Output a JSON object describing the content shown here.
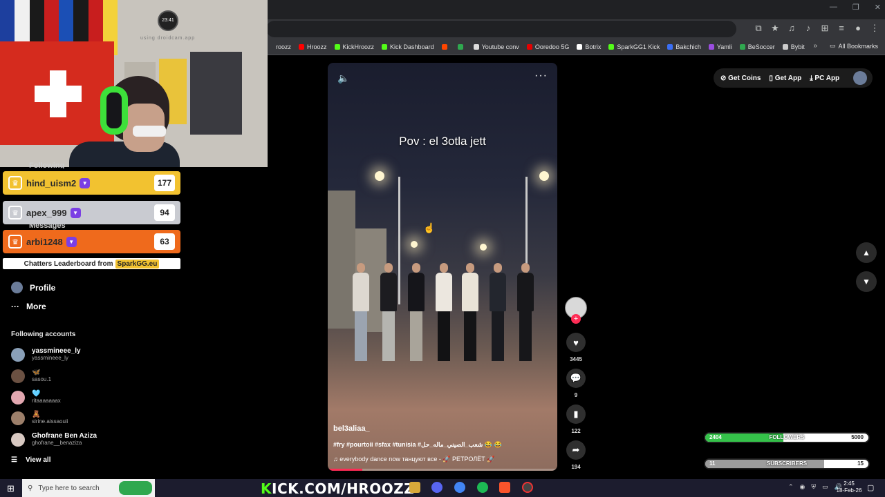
{
  "browser": {
    "window_controls": [
      "—",
      "❐",
      "✕"
    ],
    "toolbar_icons": [
      "screen-cast-icon",
      "star-icon",
      "music-icon",
      "audio-icon",
      "extensions-icon",
      "tab-search-icon",
      "profile-icon",
      "menu-icon"
    ],
    "bookmarks": [
      {
        "label": "roozz",
        "color": "#35363a"
      },
      {
        "label": "Hroozz",
        "color": "#ff0000"
      },
      {
        "label": "KickHroozz",
        "color": "#53fc18"
      },
      {
        "label": "Kick Dashboard",
        "color": "#53fc18"
      },
      {
        "label": "",
        "color": "#ff4500"
      },
      {
        "label": "",
        "color": "#2fa84f"
      },
      {
        "label": "Youtube conv",
        "color": "#dddddd"
      },
      {
        "label": "Ooredoo 5G",
        "color": "#e60000"
      },
      {
        "label": "Botrix",
        "color": "#ffffff"
      },
      {
        "label": "SparkGG1 Kick",
        "color": "#53fc18"
      },
      {
        "label": "Bakchich",
        "color": "#3a6ff7"
      },
      {
        "label": "Yamli",
        "color": "#9b4de0"
      },
      {
        "label": "BeSoccer",
        "color": "#2fa84f"
      },
      {
        "label": "Bybit",
        "color": "#cccccc"
      }
    ],
    "more_bookmarks": "»",
    "all_bookmarks": "All Bookmarks"
  },
  "webcam": {
    "clock_label": "23:41",
    "watermark": "using droidcam.app"
  },
  "sidebar": {
    "partial_labels": [
      "Following",
      "Messages"
    ],
    "leaderboard": [
      {
        "name": "hind_uism2",
        "score": "177",
        "bg": "#f2c230"
      },
      {
        "name": "apex_999",
        "score": "94",
        "bg": "#c9cbd1"
      },
      {
        "name": "arbi1248",
        "score": "63",
        "bg": "#ef6a1c"
      }
    ],
    "leaderboard_footer": "Chatters Leaderboard from",
    "leaderboard_brand": "SparkGG.eu",
    "profile": "Profile",
    "more": "More",
    "more_icon": "···",
    "following_title": "Following accounts",
    "accounts": [
      {
        "name": "yassmineee_ly",
        "handle": "yassmineee_ly",
        "color": "#8aa0b8"
      },
      {
        "name": "🦋",
        "handle": "sasou.1",
        "color": "#6b5142"
      },
      {
        "name": "🩵",
        "handle": "ritaaaaaaax",
        "color": "#e2a7b0"
      },
      {
        "name": "🧸",
        "handle": "sirine.aissaouii",
        "color": "#9c7f6a"
      },
      {
        "name": "Ghofrane Ben Aziza",
        "handle": "ghofrane__benaziza",
        "color": "#d8c9c2"
      }
    ],
    "view_all": "View all"
  },
  "video": {
    "overlay_text": "Pov : el 3otla jett",
    "username": "bel3aliaa_",
    "caption": "#fry #pourtoii #sfax #tunisia #شعب_الصيني_ماله_حل 😂 😂",
    "music": "everybody dance now танцуют все - 🚀 РЕТРОЛЁТ 🚀",
    "more_icon": "···",
    "progress_fraction": 0.15
  },
  "actions": {
    "likes": "3445",
    "comments": "9",
    "saves": "122",
    "shares": "194"
  },
  "top_actions": {
    "get_coins": "Get Coins",
    "get_app": "Get App",
    "pc_app": "PC App"
  },
  "goals": {
    "followers": {
      "current": "2404",
      "label": "FOLLOWERS",
      "target": "5000",
      "fraction": 0.48,
      "color": "#35c24a"
    },
    "subscribers": {
      "current": "11",
      "label": "SUBSCRIBERS",
      "target": "15",
      "fraction": 0.73,
      "color": "#9c9c9c"
    }
  },
  "taskbar": {
    "search_placeholder": "Type here to search",
    "brand_k": "K",
    "brand_rest": "ICK.COM/HROOZZ",
    "time": "2:45",
    "date": "18-Feb-26"
  }
}
